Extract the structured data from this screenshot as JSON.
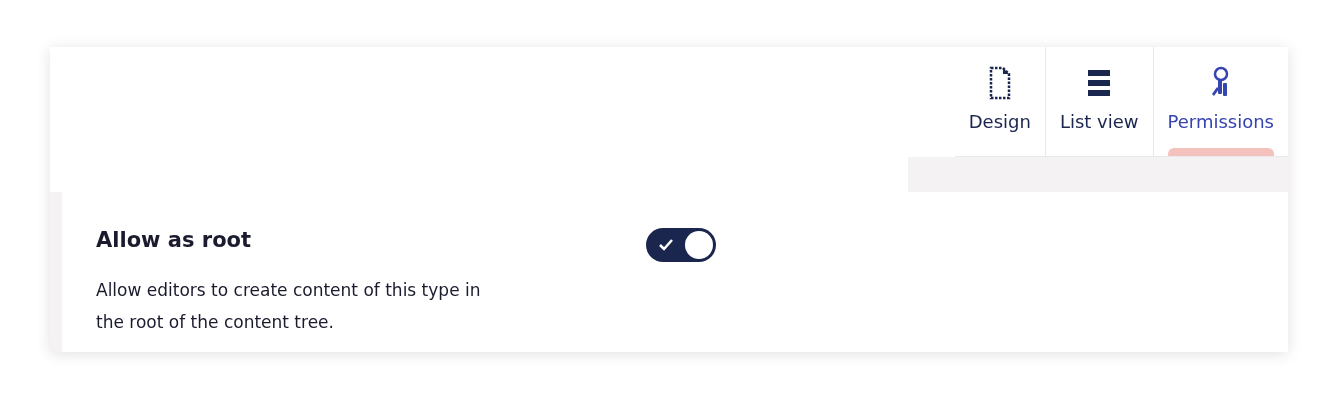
{
  "tabs": [
    {
      "label": "Design",
      "kind": "document",
      "selected": false
    },
    {
      "label": "List view",
      "kind": "list",
      "selected": false
    },
    {
      "label": "Permissions",
      "kind": "keys",
      "selected": true
    }
  ],
  "setting": {
    "title": "Allow as root",
    "description": "Allow editors to create content of this type in the root of the content tree.",
    "on": true
  }
}
